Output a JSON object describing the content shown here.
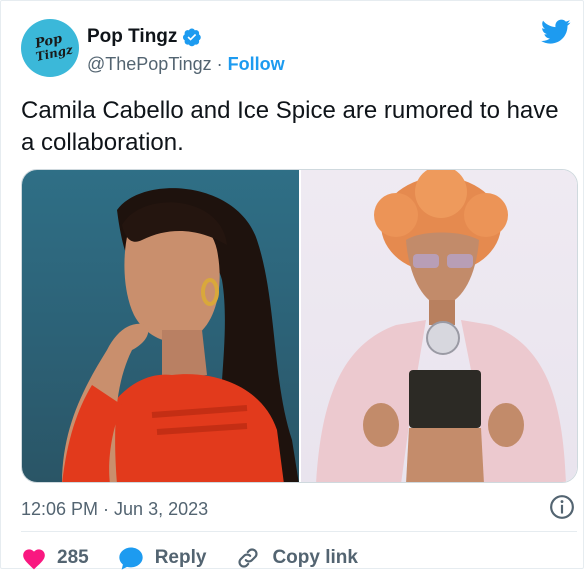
{
  "author": {
    "avatar_text_line1": "Pop",
    "avatar_text_line2": "Tingz",
    "display_name": "Pop Tingz",
    "handle": "@ThePopTingz",
    "separator": "·",
    "follow_label": "Follow"
  },
  "tweet": {
    "text": "Camila Cabello and Ice Spice are rumored to have a collaboration.",
    "timestamp": "12:06 PM · Jun 3, 2023"
  },
  "actions": {
    "likes": "285",
    "reply_label": "Reply",
    "copy_link_label": "Copy link"
  },
  "media": {
    "image_count": 2
  },
  "colors": {
    "accent": "#1d9bf0",
    "like": "#f91880",
    "muted": "#536471"
  },
  "icons": [
    "twitter-icon",
    "verified-icon",
    "info-icon",
    "heart-icon",
    "reply-icon",
    "link-icon"
  ]
}
